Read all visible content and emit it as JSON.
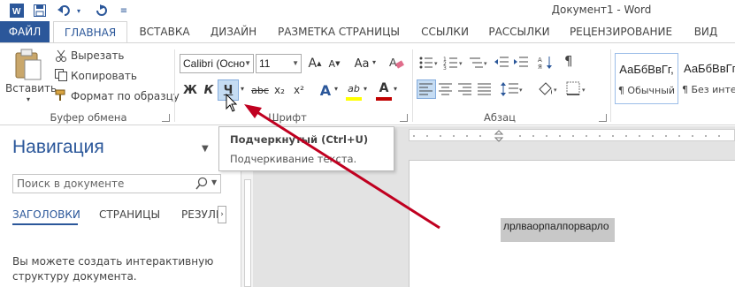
{
  "title_bar": {
    "document_title": "Документ1 - Word",
    "quick_access": [
      "word-logo-icon",
      "save-icon",
      "undo-icon",
      "undo-dropdown-icon",
      "redo-icon",
      "customize-qat-icon"
    ]
  },
  "tabs": [
    "ФАЙЛ",
    "ГЛАВНАЯ",
    "ВСТАВКА",
    "ДИЗАЙН",
    "РАЗМЕТКА СТРАНИЦЫ",
    "ССЫЛКИ",
    "РАССЫЛКИ",
    "РЕЦЕНЗИРОВАНИЕ",
    "ВИД"
  ],
  "clipboard": {
    "paste_label": "Вставить",
    "cut_label": "Вырезать",
    "copy_label": "Копировать",
    "format_painter_label": "Формат по образцу",
    "group_label": "Буфер обмена"
  },
  "font": {
    "font_name": "Calibri (Осно",
    "font_size": "11",
    "bold": "Ж",
    "italic": "К",
    "underline": "Ч",
    "strikethrough": "abc",
    "subscript": "x₂",
    "superscript": "x²",
    "grow": "A",
    "shrink": "A",
    "case": "Aa",
    "effects": "A",
    "highlight": "ab",
    "font_color": "A",
    "group_label": "Шрифт"
  },
  "paragraph": {
    "group_label": "Абзац"
  },
  "styles": {
    "items": [
      {
        "sample": "АаБбВвГг,",
        "name": "¶ Обычный"
      },
      {
        "sample": "АаБбВвГг",
        "name": "¶ Без инте..."
      }
    ]
  },
  "tooltip": {
    "title": "Подчеркнутый (Ctrl+U)",
    "description": "Подчеркивание текста."
  },
  "navigation": {
    "title": "Навигация",
    "search_placeholder": "Поиск в документе",
    "tabs": [
      "ЗАГОЛОВКИ",
      "СТРАНИЦЫ",
      "РЕЗУЛЬ"
    ],
    "hint": "Вы можете создать интерактивную структуру документа."
  },
  "document": {
    "selected_text": "лрлваорпалпорварло"
  },
  "colors": {
    "accent": "#2b579a",
    "font_color_bar": "#c00000",
    "highlight_bar": "#ffff00",
    "arrow": "#c00020"
  }
}
